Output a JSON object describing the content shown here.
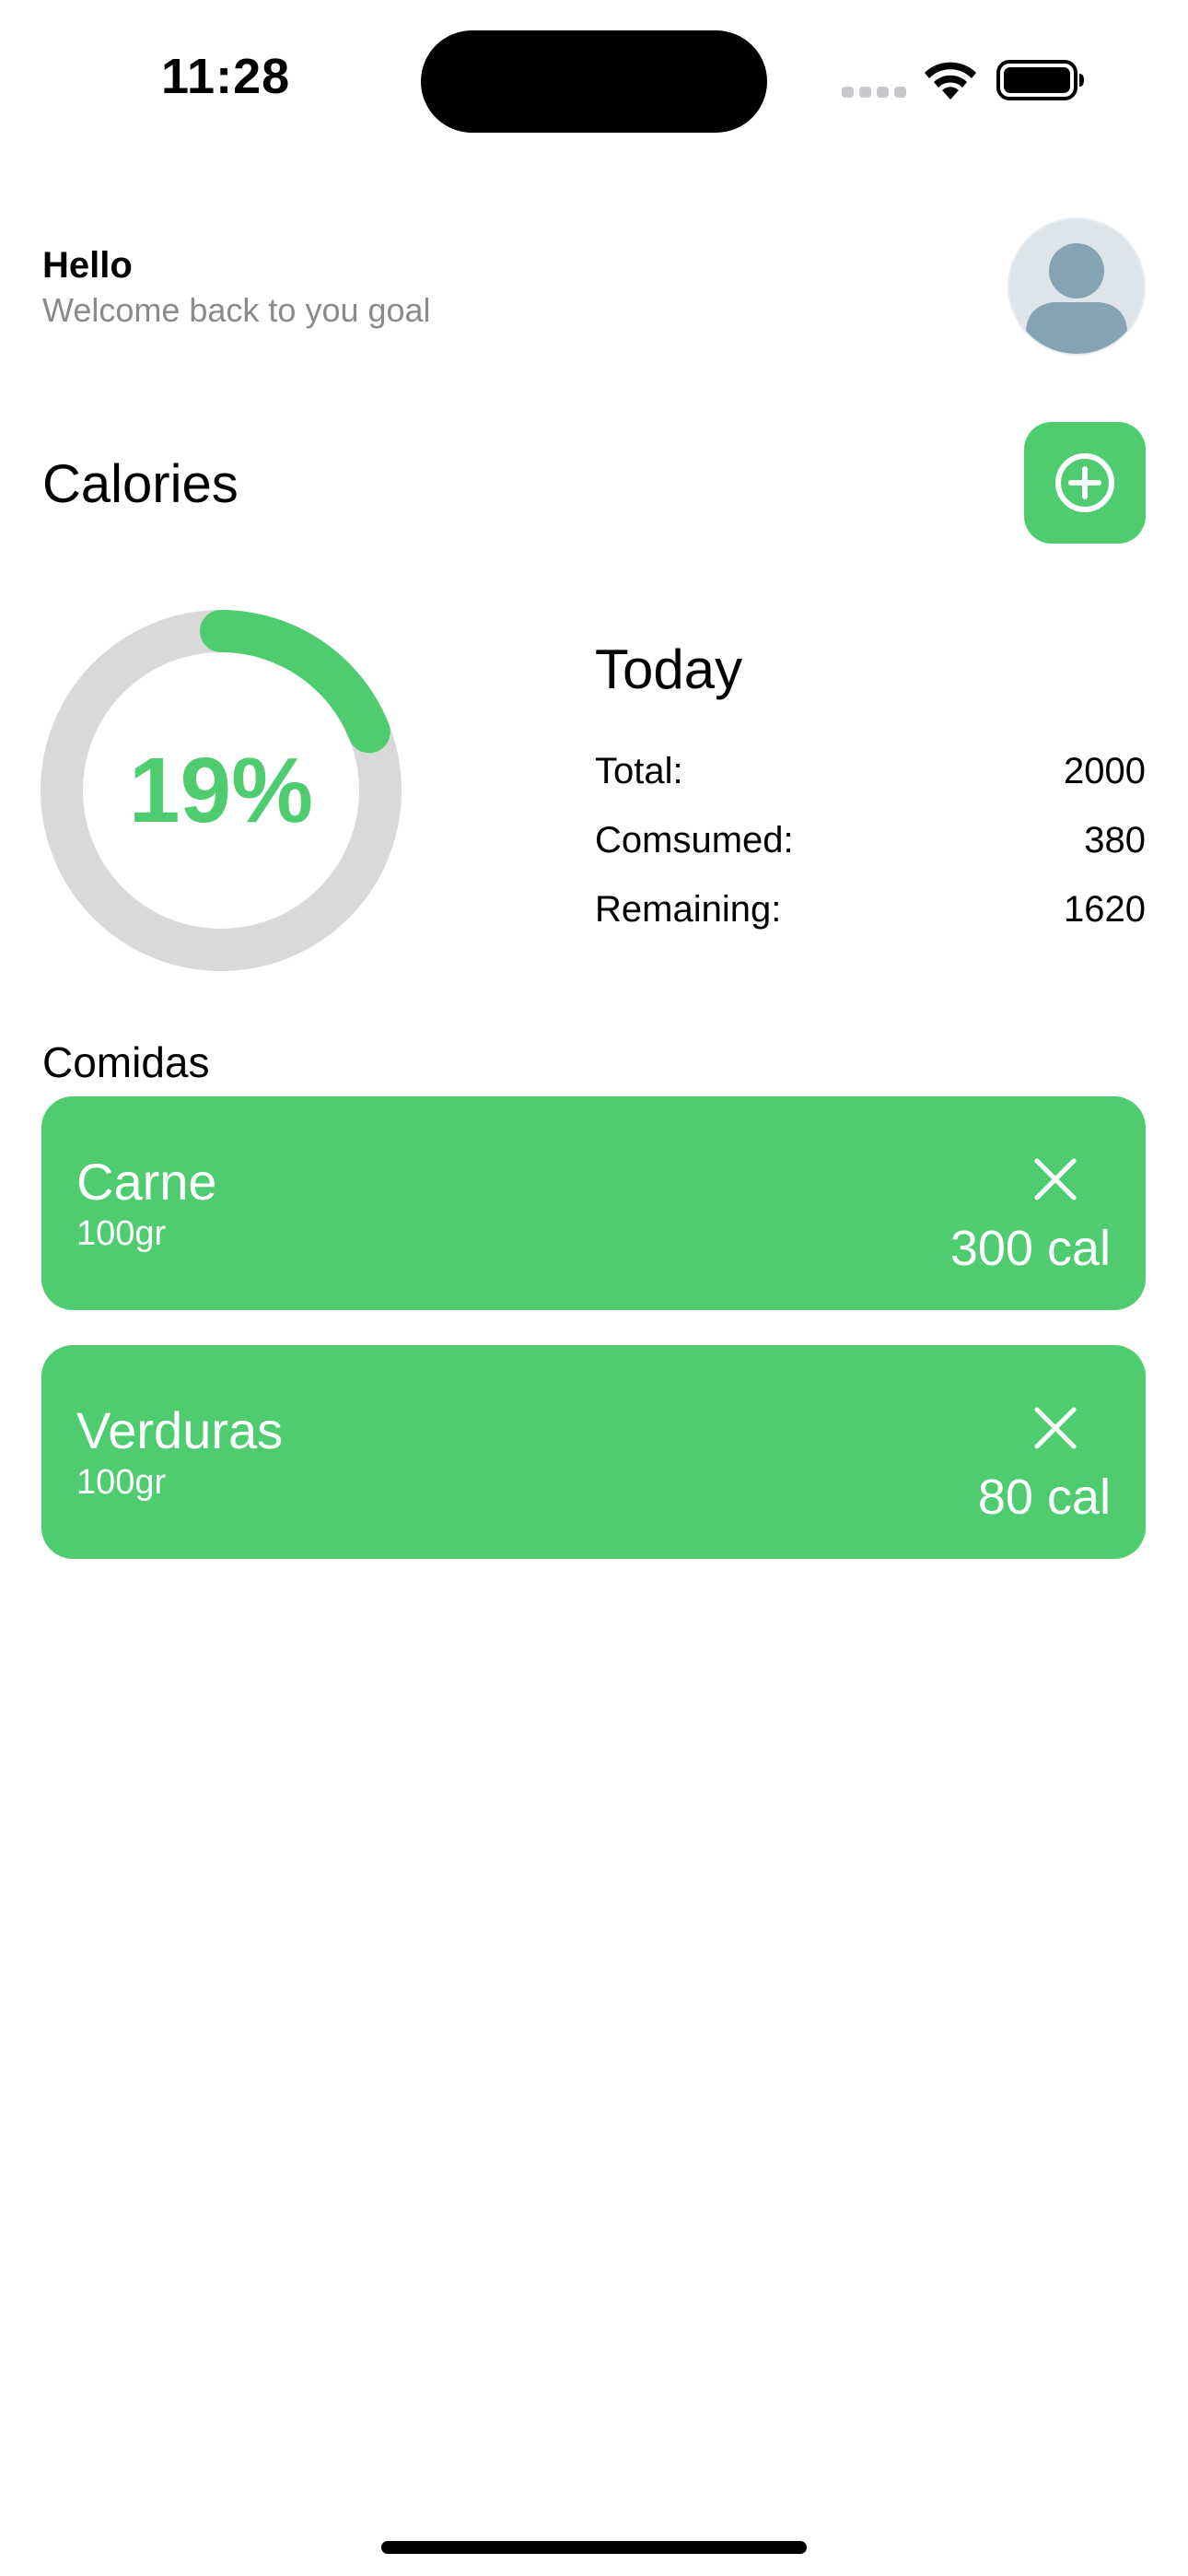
{
  "status_bar": {
    "time": "11:28"
  },
  "header": {
    "greeting": "Hello",
    "subtitle": "Welcome back to you goal",
    "avatar_icon": "person-avatar-icon"
  },
  "calories": {
    "title": "Calories",
    "add_icon": "plus-circle-icon",
    "progress": {
      "label": "19%",
      "fraction": 0.19,
      "track_color": "#d9d9d9",
      "fill_color": "#50cc70"
    },
    "today": {
      "title": "Today",
      "rows": [
        {
          "label": "Total:",
          "value": "2000"
        },
        {
          "label": "Comsumed:",
          "value": "380"
        },
        {
          "label": "Remaining:",
          "value": "1620"
        }
      ]
    }
  },
  "meals": {
    "title": "Comidas",
    "items": [
      {
        "name": "Carne",
        "amount": "100gr",
        "calories": "300 cal",
        "remove_icon": "close-icon"
      },
      {
        "name": "Verduras",
        "amount": "100gr",
        "calories": "80 cal",
        "remove_icon": "close-icon"
      }
    ]
  },
  "colors": {
    "accent": "#50cc70",
    "secondary_text": "#8a8a8e"
  }
}
